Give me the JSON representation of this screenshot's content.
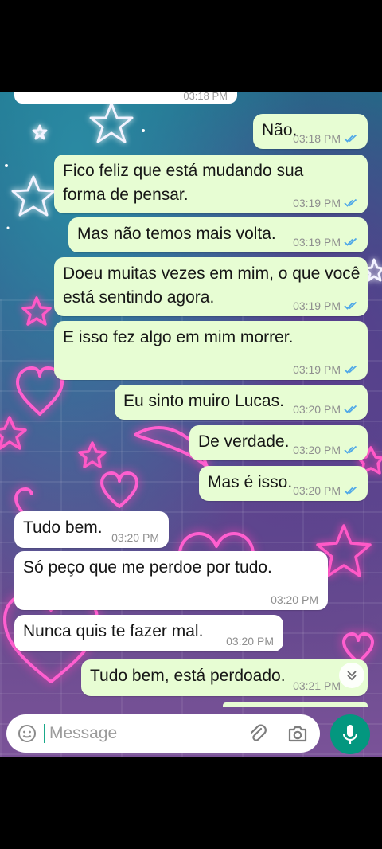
{
  "colors": {
    "outgoing_bubble": "#e7fdd3",
    "incoming_bubble": "#ffffff",
    "read_ticks": "#4fa8e8",
    "mic_button": "#03977f"
  },
  "top_partial": {
    "time": "03:18 PM"
  },
  "messages": [
    {
      "dir": "out",
      "text": "Não.",
      "time": "03:18 PM",
      "read": true
    },
    {
      "dir": "out",
      "text": "Fico feliz que está mudando sua forma de pensar.",
      "time": "03:19 PM",
      "read": true
    },
    {
      "dir": "out",
      "text": "Mas não temos mais volta.",
      "time": "03:19 PM",
      "read": true
    },
    {
      "dir": "out",
      "text": "Doeu muitas vezes em mim, o que você está sentindo agora.",
      "time": "03:19 PM",
      "read": true
    },
    {
      "dir": "out",
      "text": "E isso fez algo em mim morrer.",
      "time": "03:19 PM",
      "read": true
    },
    {
      "dir": "out",
      "text": "Eu sinto muiro Lucas.",
      "time": "03:20 PM",
      "read": true
    },
    {
      "dir": "out",
      "text": "De verdade.",
      "time": "03:20 PM",
      "read": true
    },
    {
      "dir": "out",
      "text": "Mas é isso.",
      "time": "03:20 PM",
      "read": true
    },
    {
      "dir": "in",
      "text": "Tudo bem.",
      "time": "03:20 PM"
    },
    {
      "dir": "in",
      "text": "Só peço que me perdoe por tudo.",
      "time": "03:20 PM"
    },
    {
      "dir": "in",
      "text": "Nunca quis te fazer mal.",
      "time": "03:20 PM"
    },
    {
      "dir": "out",
      "text": "Tudo bem, está perdoado.",
      "time": "03:21 PM"
    }
  ],
  "input": {
    "placeholder": "Message"
  },
  "icons": {
    "emoji": "emoji-icon",
    "attach": "paperclip-icon",
    "camera": "camera-icon",
    "mic": "microphone-icon",
    "scroll": "chevron-double-down-icon",
    "read": "double-check-icon"
  }
}
